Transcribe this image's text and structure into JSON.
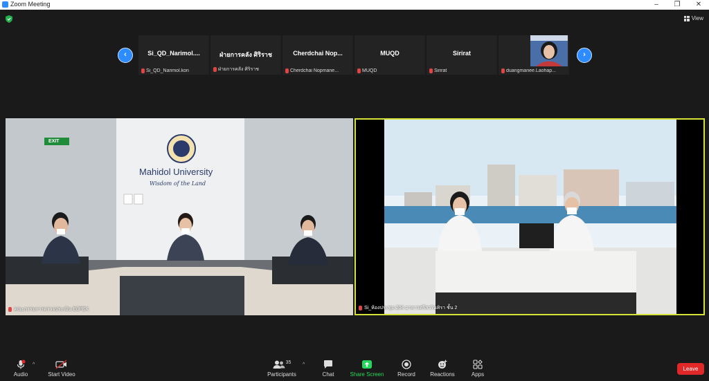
{
  "window": {
    "title": "Zoom Meeting",
    "minimize": "–",
    "maximize": "❐",
    "close": "✕"
  },
  "topbar": {
    "view_label": "View"
  },
  "strip": {
    "prev": "‹",
    "next": "›",
    "participants": [
      {
        "name": "Si_QD_Narimol....",
        "sub": "Si_QD_Narimol.kon"
      },
      {
        "name": "ฝ่ายการคลัง ศิริราช",
        "sub": "ฝ่ายการคลัง ศิริราช"
      },
      {
        "name": "Cherdchai  Nop...",
        "sub": "Cherdchai Nopmane..."
      },
      {
        "name": "MUQD",
        "sub": "MUQD"
      },
      {
        "name": "Sirirat",
        "sub": "Sirirat"
      },
      {
        "name": "",
        "sub": "duangmanee.Laohap..."
      }
    ]
  },
  "videos": {
    "left": {
      "caption": "คณะกรรมการตรวจประเมิน EdPEX",
      "sign_title": "Mahidol University",
      "sign_sub": "Wisdom of the Land",
      "exit": "EXIT"
    },
    "right": {
      "caption": "Si_ห้องประชุม 204 อาคารศรีสวรินทิรา ชั้น 2"
    }
  },
  "toolbar": {
    "audio": "Audio",
    "start_video": "Start Video",
    "participants": "Participants",
    "participants_count": "35",
    "chat": "Chat",
    "share_screen": "Share Screen",
    "record": "Record",
    "reactions": "Reactions",
    "apps": "Apps",
    "leave": "Leave",
    "caret": "^"
  },
  "colors": {
    "accent": "#2d8cff",
    "active_speaker": "#d6e43a",
    "share_green": "#23d959",
    "leave_red": "#e02828"
  }
}
